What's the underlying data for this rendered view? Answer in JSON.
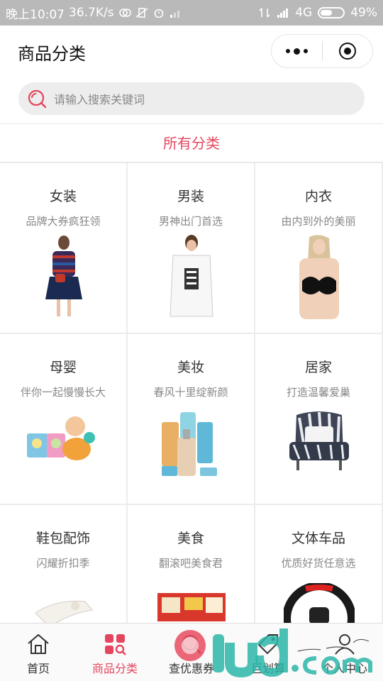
{
  "status_bar": {
    "time": "晚上10:07",
    "speed": "36.7K/s",
    "network": "4G",
    "battery": "49%"
  },
  "header": {
    "title": "商品分类"
  },
  "search": {
    "placeholder": "请输入搜索关键词"
  },
  "section_title": "所有分类",
  "categories": [
    {
      "name": "女装",
      "subtitle": "品牌大券疯狂领"
    },
    {
      "name": "男装",
      "subtitle": "男神出门首选"
    },
    {
      "name": "内衣",
      "subtitle": "由内到外的美丽"
    },
    {
      "name": "母婴",
      "subtitle": "伴你一起慢慢长大"
    },
    {
      "name": "美妆",
      "subtitle": "春风十里绽新颜"
    },
    {
      "name": "居家",
      "subtitle": "打造温馨爱巢"
    },
    {
      "name": "鞋包配饰",
      "subtitle": "闪耀折扣季"
    },
    {
      "name": "美食",
      "subtitle": "翻滚吧美食君"
    },
    {
      "name": "文体车品",
      "subtitle": "优质好货任意选"
    }
  ],
  "tabbar": {
    "items": [
      {
        "label": "首页",
        "icon": "home-icon"
      },
      {
        "label": "商品分类",
        "icon": "category-icon"
      },
      {
        "label": "查优惠券",
        "icon": "coupon-search-icon"
      },
      {
        "label": "巨划算",
        "icon": "tag-icon"
      },
      {
        "label": "个人中心",
        "icon": "user-icon"
      }
    ]
  },
  "colors": {
    "accent": "#e5455e",
    "status_bar": "#b9b9b9"
  }
}
